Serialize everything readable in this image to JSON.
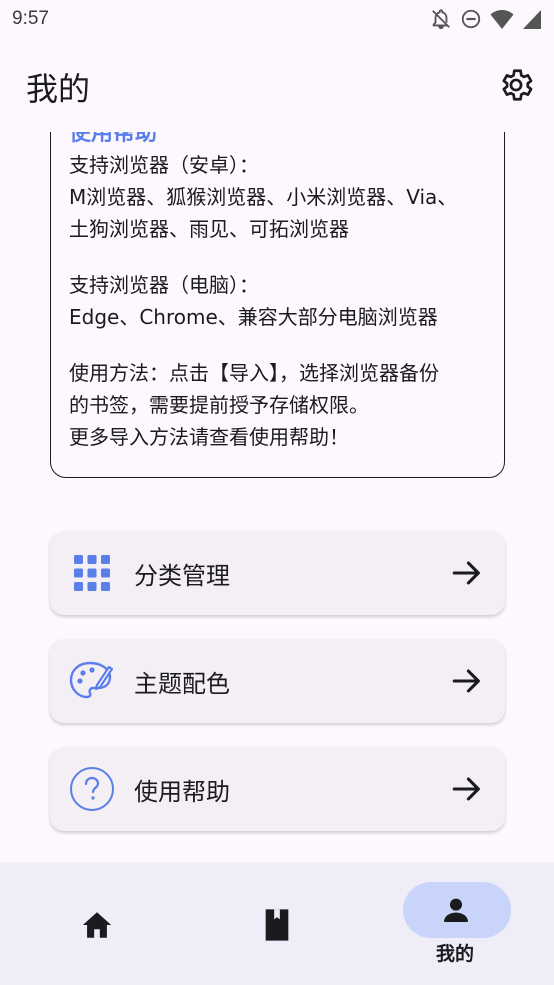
{
  "status_bar": {
    "time": "9:57",
    "icons": [
      "notifications-off-icon",
      "do-not-disturb-icon",
      "wifi-icon",
      "signal-icon"
    ]
  },
  "app_bar": {
    "title": "我的",
    "settings_icon": "gear-icon"
  },
  "info_card": {
    "heading": "使用帮助",
    "android_title": "支持浏览器（安卓）：",
    "android_line1": "M浏览器、狐猴浏览器、小米浏览器、Via、",
    "android_line2": "土狗浏览器、雨见、可拓浏览器",
    "pc_title": "支持浏览器（电脑）：",
    "pc_line1": "Edge、Chrome、兼容大部分电脑浏览器",
    "usage_line1": "使用方法：点击【导入】，选择浏览器备份",
    "usage_line2": "的书签，需要提前授予存储权限。",
    "usage_line3": "更多导入方法请查看使用帮助！"
  },
  "menu": [
    {
      "label": "分类管理",
      "icon": "apps-grid-icon"
    },
    {
      "label": "主题配色",
      "icon": "palette-icon"
    },
    {
      "label": "使用帮助",
      "icon": "help-circle-icon"
    }
  ],
  "bottom_nav": {
    "items": [
      {
        "icon": "home-icon",
        "label": ""
      },
      {
        "icon": "bookmark-book-icon",
        "label": ""
      },
      {
        "icon": "person-icon",
        "label": "我的"
      }
    ],
    "active_index": 2
  },
  "colors": {
    "accent": "#5b7fe8",
    "nav_indicator": "#c9d4fb",
    "background": "#fdf8fd"
  }
}
